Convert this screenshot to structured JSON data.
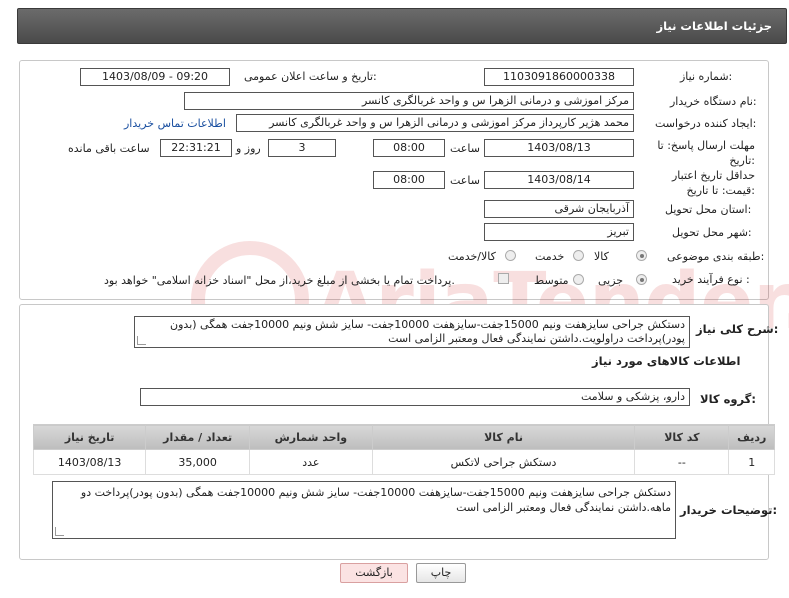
{
  "header": {
    "title": "جزئیات اطلاعات نیاز"
  },
  "form": {
    "need_number_label": "شماره نیاز:",
    "need_number": "1103091860000338",
    "announce_label": "تاریخ و ساعت اعلان عمومی:",
    "announce_value": "1403/08/09 - 09:20",
    "buyer_org_label": "نام دستگاه خریدار:",
    "buyer_org": "مرکز اموزشی و درمانی الزهرا س  و واحد غربالگری کانسر",
    "creator_label": "ایجاد کننده درخواست:",
    "creator": "محمد هژیر کارپرداز مرکز اموزشی و درمانی الزهرا س  و واحد غربالگری کانسر",
    "contact_link": "اطلاعات تماس خریدار",
    "deadline_label": "مهلت ارسال پاسخ: تا تاریخ:",
    "deadline_date": "1403/08/13",
    "time_label": "ساعت",
    "deadline_time": "08:00",
    "days_value": "3",
    "days_label": "روز و",
    "remaining_time": "22:31:21",
    "remaining_label": "ساعت باقی مانده",
    "validity_label": "حداقل تاریخ اعتبار قیمت: تا تاریخ:",
    "validity_date": "1403/08/14",
    "validity_time": "08:00",
    "province_label": "استان محل تحویل:",
    "province": "آذربایجان شرقی",
    "city_label": "شهر محل تحویل:",
    "city": "تبریز",
    "category_label": "طبقه بندی موضوعی:",
    "category_options": [
      "کالا",
      "خدمت",
      "کالا/خدمت"
    ],
    "process_label": "نوع فرآیند خرید :",
    "process_options": [
      "جزیی",
      "متوسط"
    ],
    "payment_note": "پرداخت تمام یا بخشی از مبلغ خرید،از محل \"اسناد خزانه اسلامی\" خواهد بود."
  },
  "summary": {
    "label": "شرح کلی نیاز:",
    "text": "دستکش جراحی سایزهفت ونیم 15000جفت-سایزهفت 10000جفت- سایز شش ونیم 10000جفت همگی (بدون پودر)پرداخت دراولویت.داشتن نمایندگی فعال ومعتبر الزامی است"
  },
  "goods": {
    "section_title": "اطلاعات کالاهای مورد نیاز",
    "group_label": "گروه کالا:",
    "group_value": "دارو، پزشکی و سلامت",
    "columns": [
      "ردیف",
      "کد کالا",
      "نام کالا",
      "واحد شمارش",
      "تعداد / مقدار",
      "تاریخ نیاز"
    ],
    "rows": [
      [
        "1",
        "--",
        "دستکش جراحی لاتکس",
        "عدد",
        "35,000",
        "1403/08/13"
      ]
    ]
  },
  "buyer_notes": {
    "label": "توضیحات خریدار:",
    "text": "دستکش جراحی سایزهفت ونیم 15000جفت-سایزهفت 10000جفت- سایز شش ونیم 10000جفت همگی (بدون پودر)پرداخت دو ماهه.داشتن نمایندگی فعال ومعتبر الزامی است"
  },
  "buttons": {
    "print": "چاپ",
    "back": "بازگشت"
  },
  "watermark_text": "AriaTender.neT"
}
